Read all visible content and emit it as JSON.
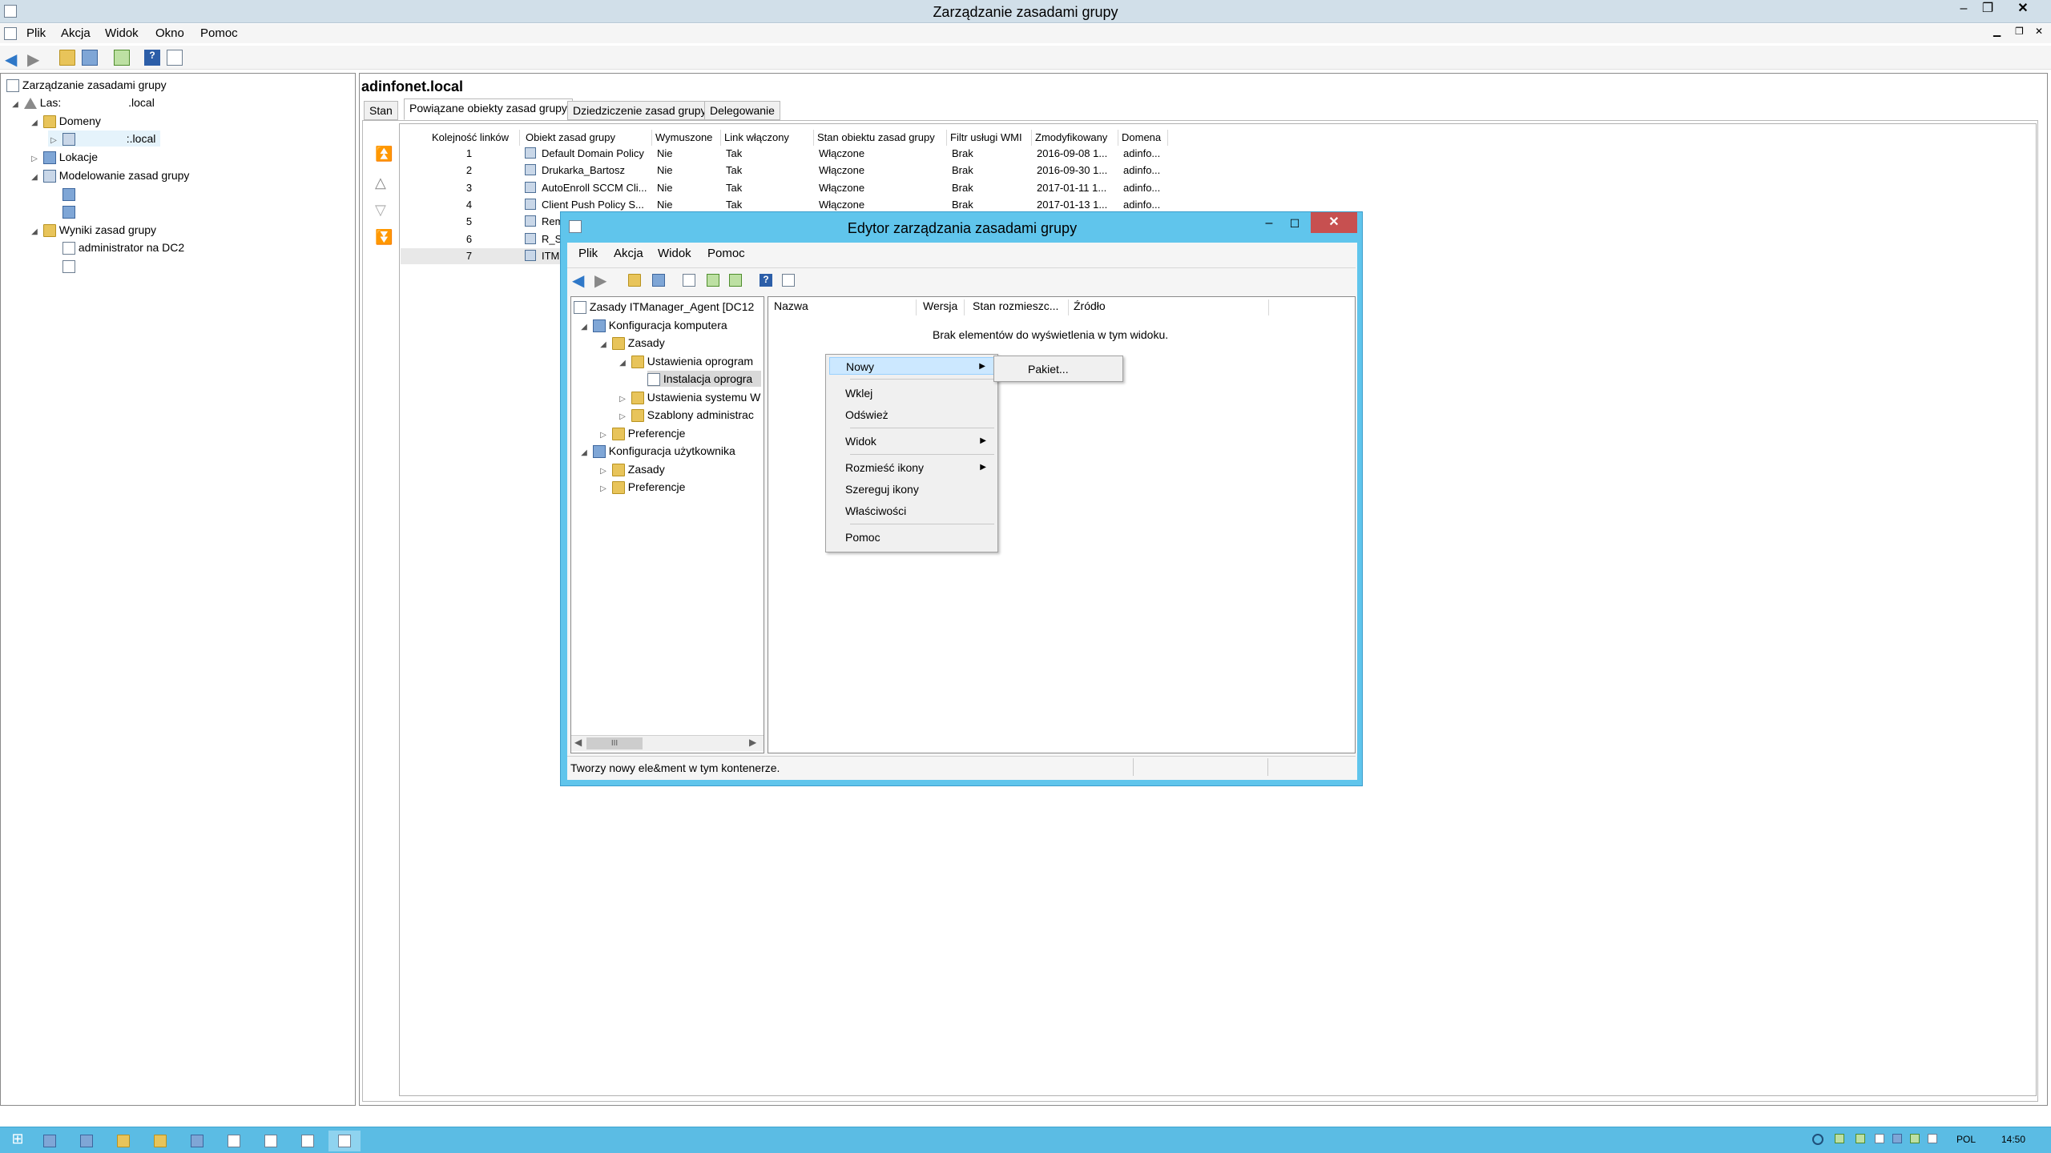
{
  "window": {
    "title": "Zarządzanie zasadami grupy"
  },
  "menu": [
    "Plik",
    "Akcja",
    "Widok",
    "Okno",
    "Pomoc"
  ],
  "tree": {
    "root": "Zarządzanie zasadami grupy",
    "forest": "Las:",
    "forest_suffix": ".local",
    "domains": "Domeny",
    "domain_suffix": ":.local",
    "sites": "Lokacje",
    "modeling": "Modelowanie zasad grupy",
    "results": "Wyniki zasad grupy",
    "result_item": "administrator na DC2"
  },
  "right": {
    "heading": "adinfonet.local",
    "tabs": [
      "Stan",
      "Powiązane obiekty zasad grupy",
      "Dziedziczenie zasad grupy",
      "Delegowanie"
    ],
    "columns": [
      "Kolejność linków",
      "Obiekt zasad grupy",
      "Wymuszone",
      "Link włączony",
      "Stan obiektu zasad grupy",
      "Filtr usługi WMI",
      "Zmodyfikowany",
      "Domena"
    ],
    "rows": [
      {
        "order": "1",
        "name": "Default Domain Policy",
        "enforced": "Nie",
        "enabled": "Tak",
        "status": "Włączone",
        "wmi": "Brak",
        "modified": "2016-09-08 1...",
        "domain": "adinfo..."
      },
      {
        "order": "2",
        "name": "Drukarka_Bartosz",
        "enforced": "Nie",
        "enabled": "Tak",
        "status": "Włączone",
        "wmi": "Brak",
        "modified": "2016-09-30 1...",
        "domain": "adinfo..."
      },
      {
        "order": "3",
        "name": "AutoEnroll SCCM Cli...",
        "enforced": "Nie",
        "enabled": "Tak",
        "status": "Włączone",
        "wmi": "Brak",
        "modified": "2017-01-11 1...",
        "domain": "adinfo..."
      },
      {
        "order": "4",
        "name": "Client Push Policy S...",
        "enforced": "Nie",
        "enabled": "Tak",
        "status": "Włączone",
        "wmi": "Brak",
        "modified": "2017-01-13 1...",
        "domain": "adinfo..."
      },
      {
        "order": "5",
        "name": "Rem",
        "enforced": "",
        "enabled": "",
        "status": "",
        "wmi": "",
        "modified": "",
        "domain": ""
      },
      {
        "order": "6",
        "name": "R_S",
        "enforced": "",
        "enabled": "",
        "status": "",
        "wmi": "",
        "modified": "",
        "domain": ""
      },
      {
        "order": "7",
        "name": "ITM",
        "enforced": "",
        "enabled": "",
        "status": "",
        "wmi": "",
        "modified": "",
        "domain": ""
      }
    ]
  },
  "dialog": {
    "title": "Edytor zarządzania zasadami grupy",
    "menu": [
      "Plik",
      "Akcja",
      "Widok",
      "Pomoc"
    ],
    "tree": [
      "Zasady ITManager_Agent [DC12",
      "Konfiguracja komputera",
      "Zasady",
      "Ustawienia oprogram",
      "Instalacja oprogra",
      "Ustawienia systemu W",
      "Szablony administrac",
      "Preferencje",
      "Konfiguracja użytkownika",
      "Zasady",
      "Preferencje"
    ],
    "scroll_mark": "III",
    "columns": [
      "Nazwa",
      "Wersja",
      "Stan rozmieszc...",
      "Źródło"
    ],
    "empty_text": "Brak elementów do wyświetlenia w tym widoku.",
    "status": "Tworzy nowy ele&ment w tym kontenerze."
  },
  "context_menu": {
    "items": [
      "Nowy",
      "Wklej",
      "Odśwież",
      "Widok",
      "Rozmieść ikony",
      "Szereguj ikony",
      "Właściwości",
      "Pomoc"
    ],
    "submenu_item": "Pakiet..."
  },
  "systray": {
    "lang": "POL",
    "time": "14:50"
  }
}
